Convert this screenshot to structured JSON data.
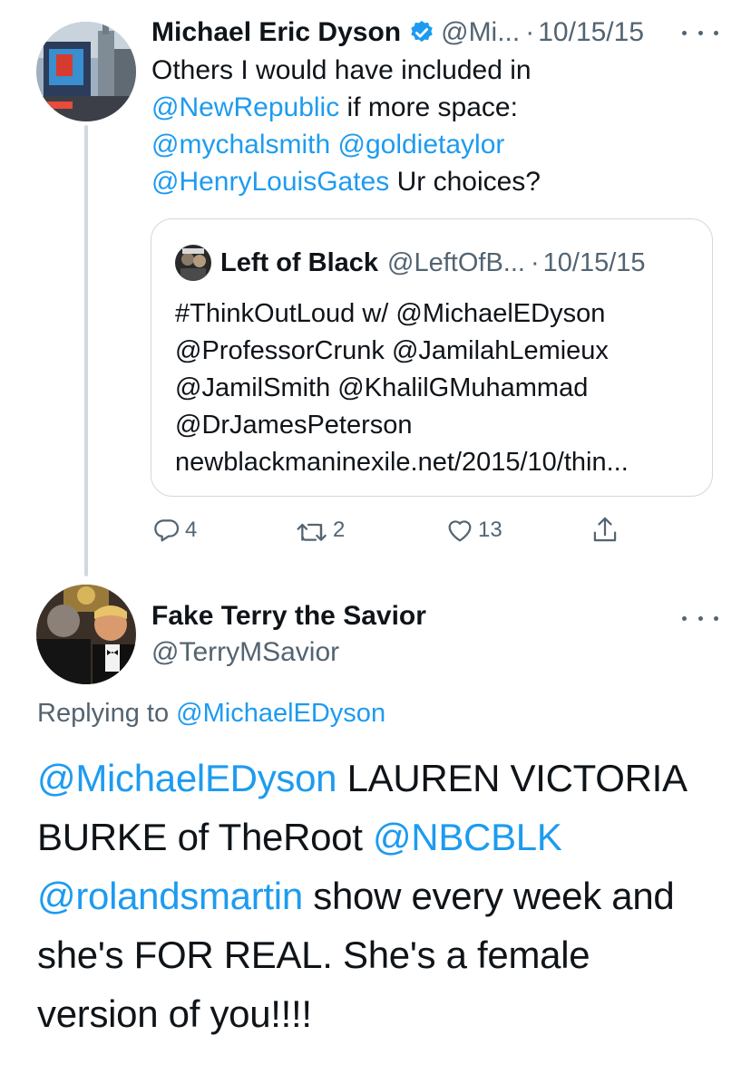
{
  "tweet1": {
    "display_name": "Michael Eric Dyson",
    "verified": true,
    "handle": "@Mi...",
    "separator": "·",
    "date": "10/15/15",
    "text_lines": [
      [
        {
          "t": "Others I would have included in",
          "link": false
        }
      ],
      [
        {
          "t": "@NewRepublic",
          "link": true
        },
        {
          "t": " if more space:",
          "link": false
        }
      ],
      [
        {
          "t": "@mychalsmith",
          "link": true
        },
        {
          "t": " ",
          "link": false
        },
        {
          "t": "@goldietaylor",
          "link": true
        }
      ],
      [
        {
          "t": "@HenryLouisGates",
          "link": true
        },
        {
          "t": " Ur choices?",
          "link": false
        }
      ]
    ],
    "quote": {
      "display_name": "Left of Black",
      "handle": "@LeftOfB...",
      "separator": "·",
      "date": "10/15/15",
      "text_lines": [
        "#ThinkOutLoud w/ @MichaelEDyson",
        "@ProfessorCrunk @JamilahLemieux",
        "@JamilSmith @KhalilGMuhammad",
        "@DrJamesPeterson",
        "newblackmaninexile.net/2015/10/thin..."
      ]
    },
    "actions": {
      "reply_count": "4",
      "retweet_count": "2",
      "like_count": "13"
    }
  },
  "tweet2": {
    "display_name": "Fake Terry the Savior",
    "handle": "@TerryMSavior",
    "replying_prefix": "Replying to ",
    "replying_handle": "@MichaelEDyson",
    "text_lines": [
      [
        {
          "t": "@MichaelEDyson",
          "link": true
        },
        {
          "t": " LAUREN VICTORIA",
          "link": false
        }
      ],
      [
        {
          "t": "BURKE of TheRoot ",
          "link": false
        },
        {
          "t": "@NBCBLK",
          "link": true
        }
      ],
      [
        {
          "t": "@rolandsmartin",
          "link": true
        },
        {
          "t": " show every week and",
          "link": false
        }
      ],
      [
        {
          "t": "she's FOR REAL. She's a female",
          "link": false
        }
      ],
      [
        {
          "t": "version of you!!!!",
          "link": false
        }
      ]
    ]
  },
  "colors": {
    "link": "#1d9bf0",
    "muted": "#536471",
    "text": "#0f1419",
    "border": "#cfd9de"
  },
  "icons": {
    "verified": "verified-badge-icon",
    "more": "more-horizontal-icon",
    "reply": "reply-icon",
    "retweet": "retweet-icon",
    "like": "heart-icon",
    "share": "share-icon"
  }
}
